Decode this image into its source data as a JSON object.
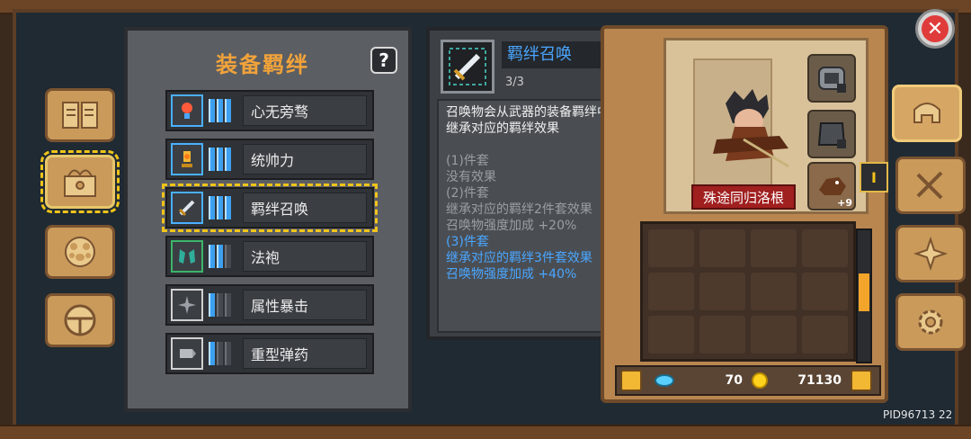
{
  "panel": {
    "title": "装备羁绊",
    "help_label": "?",
    "bonds": [
      {
        "label": "心无旁骛",
        "level": 3,
        "icon": "heart-orb-icon"
      },
      {
        "label": "统帅力",
        "level": 3,
        "icon": "trophy-lamp-icon"
      },
      {
        "label": "羁绊召唤",
        "level": 3,
        "icon": "sword-icon",
        "selected": true
      },
      {
        "label": "法袍",
        "level": 2,
        "icon": "robe-icon"
      },
      {
        "label": "属性暴击",
        "level": 1,
        "icon": "spark-icon"
      },
      {
        "label": "重型弹药",
        "level": 1,
        "icon": "ammo-icon"
      }
    ]
  },
  "tooltip": {
    "name": "羁绊召唤",
    "count": "3/3",
    "desc_line1": "召唤物会从武器的装备羁绊中",
    "desc_line2": "继承对应的羁绊效果",
    "tier1_head": "(1)件套",
    "tier1_text": "没有效果",
    "tier2_head": "(2)件套",
    "tier2_text1": "继承对应的羁绊2件套效果",
    "tier2_text2": "召唤物强度加成 +20%",
    "tier3_head": "(3)件套",
    "tier3_text1": "继承对应的羁绊3件套效果",
    "tier3_text2": "召唤物强度加成 +40%"
  },
  "character": {
    "name": "殊途同归洛根",
    "enhance": "+9",
    "arrow_label": "I"
  },
  "resources": {
    "gems": "70",
    "coins": "71130"
  },
  "footer": {
    "pid": "PID96713  22"
  },
  "close_label": "✕",
  "colors": {
    "accent_orange": "#f2a33a",
    "link_blue": "#4aa6ff",
    "selection_yellow": "#f2c419",
    "name_tag_red": "#a01f1f"
  }
}
